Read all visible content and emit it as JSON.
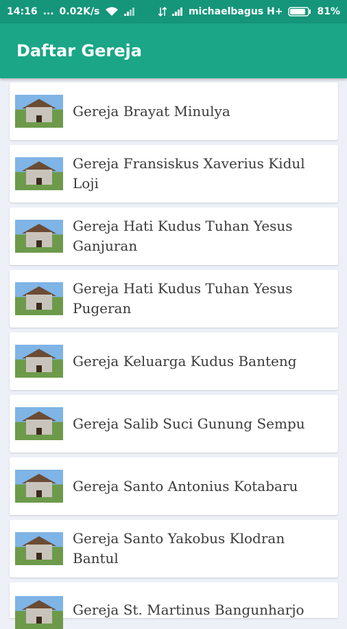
{
  "status_bar": {
    "time": "14:16",
    "dots": "...",
    "speed": "0.02K/s",
    "carrier": "michaelbagus H+",
    "battery": "81%",
    "icons": [
      "wifi-icon",
      "signal-icon",
      "data-arrows-icon",
      "signal-icon",
      "battery-icon"
    ]
  },
  "app_bar": {
    "title": "Daftar Gereja"
  },
  "churches": [
    {
      "name": "Gereja Brayat Minulya"
    },
    {
      "name": "Gereja Fransiskus Xaverius Kidul Loji"
    },
    {
      "name": "Gereja Hati Kudus Tuhan Yesus Ganjuran"
    },
    {
      "name": "Gereja Hati Kudus Tuhan Yesus Pugeran"
    },
    {
      "name": "Gereja Keluarga Kudus Banteng"
    },
    {
      "name": "Gereja Salib Suci Gunung Sempu"
    },
    {
      "name": "Gereja Santo Antonius Kotabaru"
    },
    {
      "name": "Gereja Santo Yakobus Klodran Bantul"
    },
    {
      "name": "Gereja St. Martinus Bangunharjo"
    }
  ],
  "colors": {
    "status_bar": "#15967b",
    "app_bar": "#1aa687",
    "background": "#eef0f8"
  }
}
